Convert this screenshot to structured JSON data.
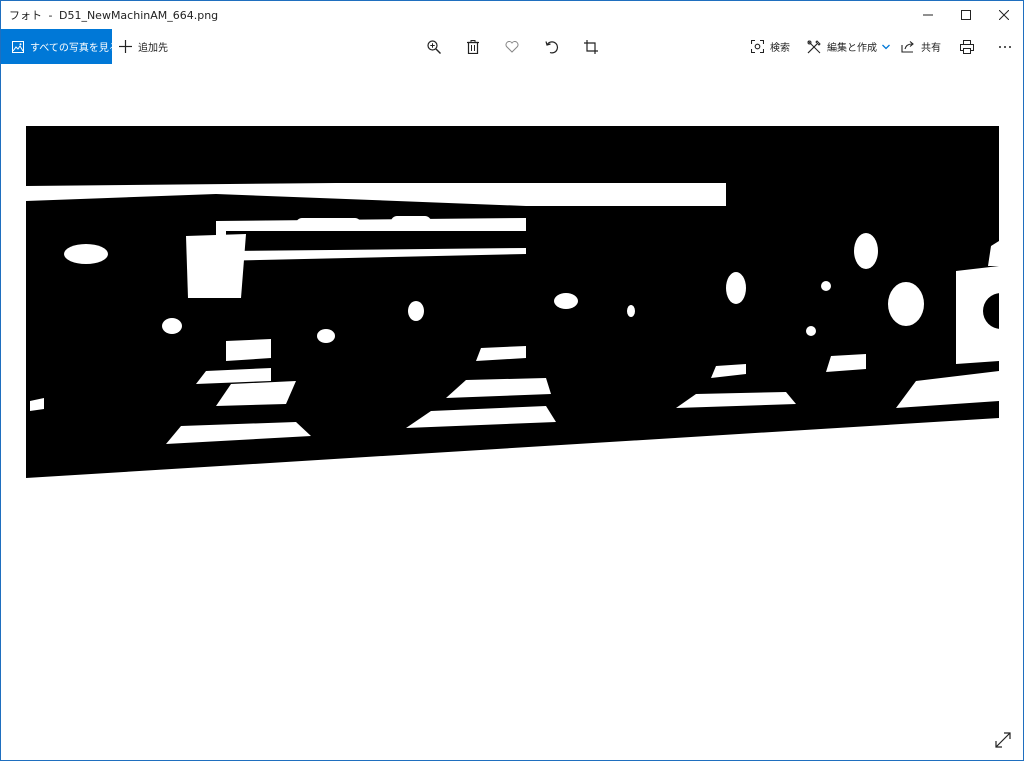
{
  "window": {
    "app_name": "フォト",
    "separator": "-",
    "file_name": "D51_NewMachinAM_664.png"
  },
  "toolbar": {
    "all_photos_label": "すべての写真を見る",
    "add_to_label": "追加先",
    "search_label": "検索",
    "edit_create_label": "編集と作成",
    "share_label": "共有"
  },
  "icons": {
    "window_minimize": "minimize-icon",
    "window_maximize": "maximize-icon",
    "window_close": "close-icon",
    "all_photos": "photos-icon",
    "add": "plus-icon",
    "zoom": "zoom-in-icon",
    "delete": "trash-icon",
    "favorite": "heart-icon",
    "rotate": "rotate-icon",
    "crop": "crop-icon",
    "search": "visual-search-icon",
    "edit": "edit-icon",
    "chevron": "chevron-down-icon",
    "share": "share-icon",
    "print": "print-icon",
    "more": "more-icon",
    "expand": "expand-icon"
  },
  "colors": {
    "accent": "#0078d7",
    "photo_black": "#000000",
    "photo_white": "#ffffff"
  }
}
